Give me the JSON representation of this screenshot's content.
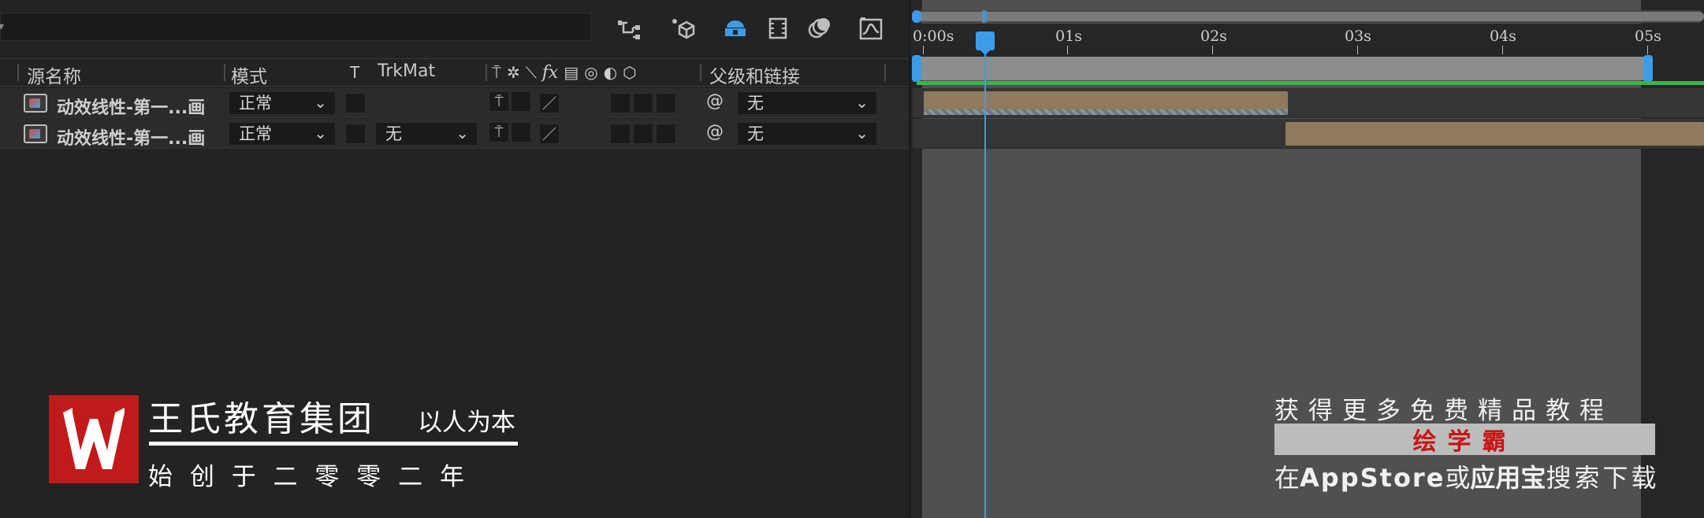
{
  "toolbar": {
    "icons": [
      "flowchart-icon",
      "draft-3d-icon",
      "solo-layers-icon",
      "frame-blending-icon",
      "motion-blur-icon",
      "graph-editor-icon"
    ]
  },
  "columns": {
    "source_name": "源名称",
    "mode": "模式",
    "t": "T",
    "trkmat": "TrkMat",
    "parent": "父级和链接"
  },
  "layers": [
    {
      "name": "动效线性-第一...画",
      "mode": "正常",
      "trkmat": "",
      "parent": "无"
    },
    {
      "name": "动效线性-第一...画",
      "mode": "正常",
      "trkmat": "无",
      "parent": "无"
    }
  ],
  "timeline": {
    "ticks": [
      "0:00s",
      "01s",
      "02s",
      "03s",
      "04s",
      "05s"
    ],
    "current_time_s": 0.5
  },
  "watermark_left": {
    "title": "王氏教育集团",
    "slogan": "以人为本",
    "subtitle": "始 创 于 二 零 零 二 年"
  },
  "watermark_right": {
    "line1": "获得更多免费精品教程",
    "brand": "绘学霸",
    "line3_pre": "在",
    "line3_app": "AppStore",
    "line3_mid": "或",
    "line3_store": "应用宝",
    "line3_post": "搜索下载"
  },
  "colors": {
    "accent": "#3d9be9",
    "clip": "#8f7a5e",
    "work_area_green": "#39b54a",
    "logo_red": "#c21a1a"
  }
}
